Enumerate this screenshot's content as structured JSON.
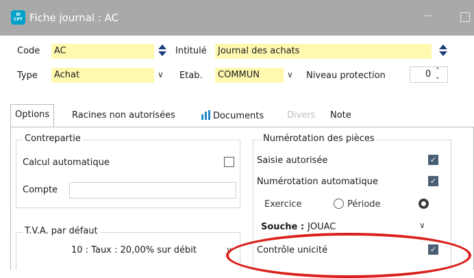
{
  "window": {
    "title": "Fiche journal : AC",
    "app_icon_text": "W CPT",
    "controls": {
      "minimize": "—"
    }
  },
  "header": {
    "code": {
      "label": "Code",
      "value": "AC"
    },
    "intitule": {
      "label": "Intitulé",
      "value": "Journal des achats"
    },
    "type": {
      "label": "Type",
      "value": "Achat"
    },
    "etab": {
      "label": "Etab.",
      "value": "COMMUN"
    },
    "niveau_protection": {
      "label": "Niveau protection",
      "value": "0"
    }
  },
  "tabs": [
    {
      "label": "Options",
      "active": true,
      "enabled": true
    },
    {
      "label": "Racines non autorisées",
      "active": false,
      "enabled": true
    },
    {
      "label": "Documents",
      "active": false,
      "enabled": true,
      "icon": "bar-chart-icon"
    },
    {
      "label": "Divers",
      "active": false,
      "enabled": false
    },
    {
      "label": "Note",
      "active": false,
      "enabled": true
    }
  ],
  "contrepartie": {
    "title": "Contrepartie",
    "calcul_automatique": {
      "label": "Calcul automatique",
      "checked": false
    },
    "compte": {
      "label": "Compte",
      "value": ""
    }
  },
  "tva": {
    "title": "T.V.A. par défaut",
    "value": "10  : Taux : 20,00% sur débit"
  },
  "numerotation": {
    "title": "Numérotation des pièces",
    "saisie_autorisee": {
      "label": "Saisie autorisée",
      "checked": true
    },
    "numerotation_automatique": {
      "label": "Numérotation automatique",
      "checked": true
    },
    "exercice": {
      "label": "Exercice",
      "selected": false
    },
    "periode": {
      "label": "Période",
      "selected": false
    },
    "souche": {
      "label": "Souche :",
      "value": "JOUAC"
    },
    "controle_unicite": {
      "label": "Contrôle unicité",
      "checked": true
    }
  },
  "colors": {
    "titlebar": "#a9a9a9",
    "field_highlight": "#fff9b0",
    "spin_arrow": "#1a3d7c",
    "annotation": "#d9201b",
    "checkbox_checked": "#4b5f74",
    "tab_disabled": "#c0c0c0"
  },
  "annotation": {
    "shape": "ellipse",
    "target": "controle_unicite"
  }
}
